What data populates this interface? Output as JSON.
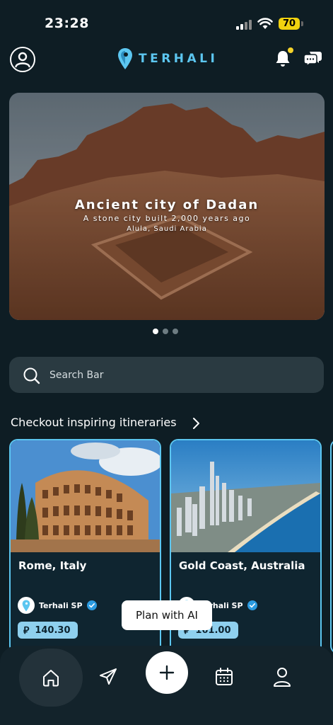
{
  "status_bar": {
    "time": "23:28",
    "battery": "70"
  },
  "header": {
    "brand": "TERHALI"
  },
  "hero": {
    "title": "Ancient city of Dadan",
    "subtitle": "A stone city built 2,000 years ago",
    "location": "Alula, Saudi Arabia",
    "active_slide": 1,
    "slide_count": 3
  },
  "search": {
    "placeholder": "Search Bar"
  },
  "itineraries": {
    "title": "Checkout inspiring itineraries",
    "cards": [
      {
        "name": "Rome, Italy",
        "author": "Terhali SP",
        "price": "140.30",
        "currency_symbol": "⃁"
      },
      {
        "name": "Gold Coast, Australia",
        "author": "Terhali SP",
        "price": "161.00",
        "currency_symbol": "⃁"
      }
    ]
  },
  "tooltip": {
    "label": "Plan with AI"
  },
  "nav": {
    "items": [
      "home",
      "explore",
      "add",
      "calendar",
      "profile"
    ]
  },
  "colors": {
    "accent": "#5cc6f0",
    "background": "#0e1d24",
    "price_chip": "#8fd0ee"
  }
}
